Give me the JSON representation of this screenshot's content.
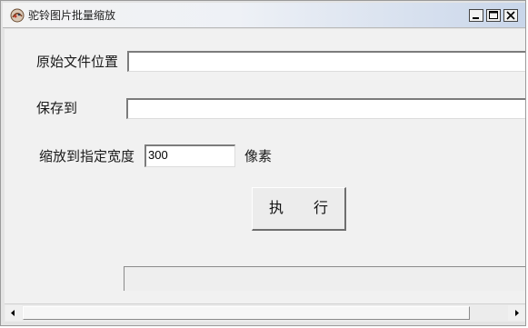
{
  "window": {
    "title": "驼铃图片批量缩放",
    "icon": "app-logo-icon",
    "controls": [
      "minimize-icon",
      "maximize-icon",
      "close-icon"
    ]
  },
  "form": {
    "source_label": "原始文件位置",
    "source_value": "",
    "save_label": "保存到",
    "save_value": "",
    "width_label": "缩放到指定宽度",
    "width_value": "300",
    "unit_label": "像素"
  },
  "actions": {
    "execute_label": "执 行"
  },
  "status": {
    "text": ""
  }
}
